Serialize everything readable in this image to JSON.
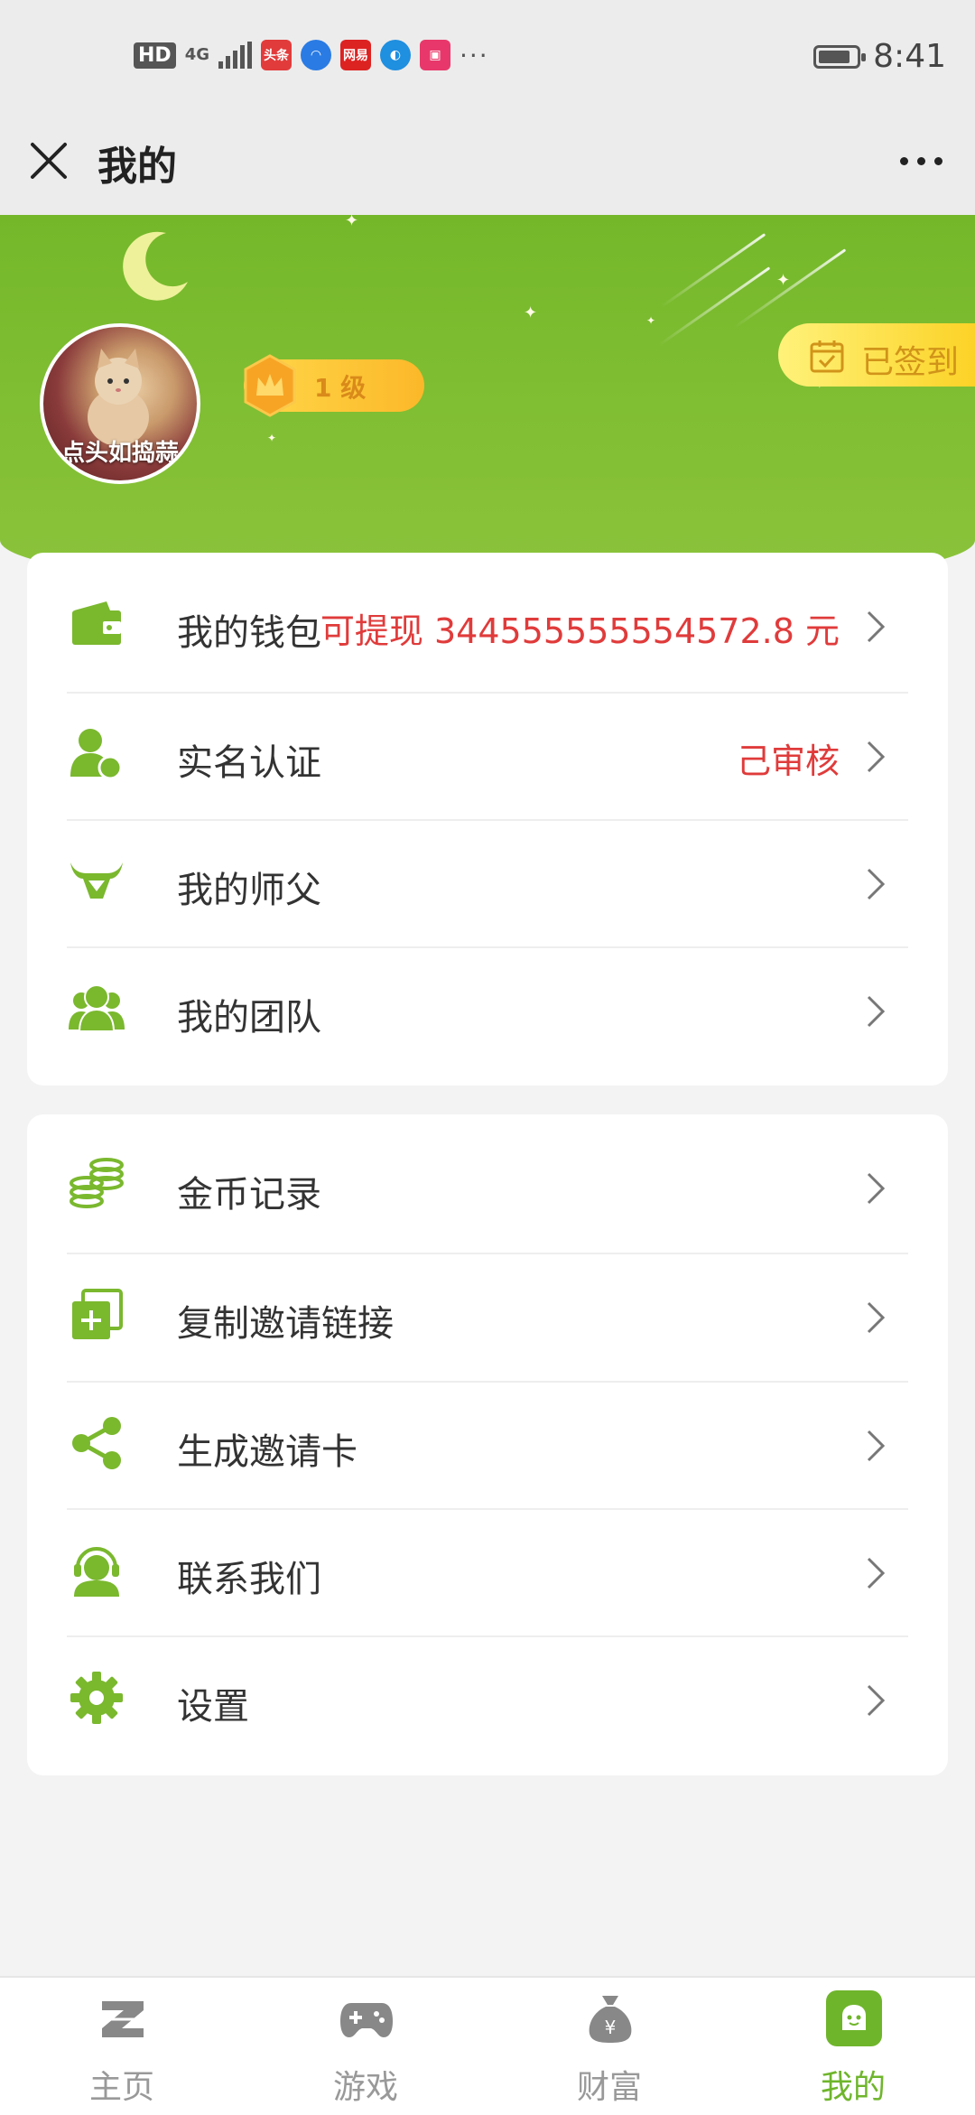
{
  "status_bar": {
    "hd": "HD",
    "network": "4G",
    "apps": [
      {
        "name": "toutiao-app-icon",
        "text": "头条",
        "color": "#e23b3b"
      },
      {
        "name": "qq-browser-app-icon",
        "text": "",
        "color": "#2a7be4"
      },
      {
        "name": "netease-app-icon",
        "text": "网易",
        "color": "#d22"
      },
      {
        "name": "browser-app-icon",
        "text": "",
        "color": "#1f8fe0"
      },
      {
        "name": "shopping-app-icon",
        "text": "",
        "color": "#e8386b"
      }
    ],
    "more": "···",
    "time": "8:41"
  },
  "titlebar": {
    "title": "我的"
  },
  "profile": {
    "avatar_caption": "点头如捣蒜",
    "level": "1 级",
    "checkin_label": "已签到"
  },
  "menu_group_1": [
    {
      "icon": "wallet-icon",
      "label": "我的钱包",
      "value": "可提现 344555555554572.8 元"
    },
    {
      "icon": "verified-user-icon",
      "label": "实名认证",
      "value": "己审核"
    },
    {
      "icon": "bull-icon",
      "label": "我的师父",
      "value": ""
    },
    {
      "icon": "team-icon",
      "label": "我的团队",
      "value": ""
    }
  ],
  "menu_group_2": [
    {
      "icon": "coins-icon",
      "label": "金币记录"
    },
    {
      "icon": "copy-link-icon",
      "label": "复制邀请链接"
    },
    {
      "icon": "share-icon",
      "label": "生成邀请卡"
    },
    {
      "icon": "customer-service-icon",
      "label": "联系我们"
    },
    {
      "icon": "settings-gear-icon",
      "label": "设置"
    }
  ],
  "bottom_nav": [
    {
      "icon": "home-z-icon",
      "label": "主页",
      "active": false
    },
    {
      "icon": "gamepad-icon",
      "label": "游戏",
      "active": false
    },
    {
      "icon": "money-bag-icon",
      "label": "财富",
      "active": false
    },
    {
      "icon": "profile-face-icon",
      "label": "我的",
      "active": true
    }
  ],
  "colors": {
    "brand_green": "#7ab82e",
    "accent_red": "#e03b3b",
    "badge_yellow": "#fbcf1e"
  }
}
